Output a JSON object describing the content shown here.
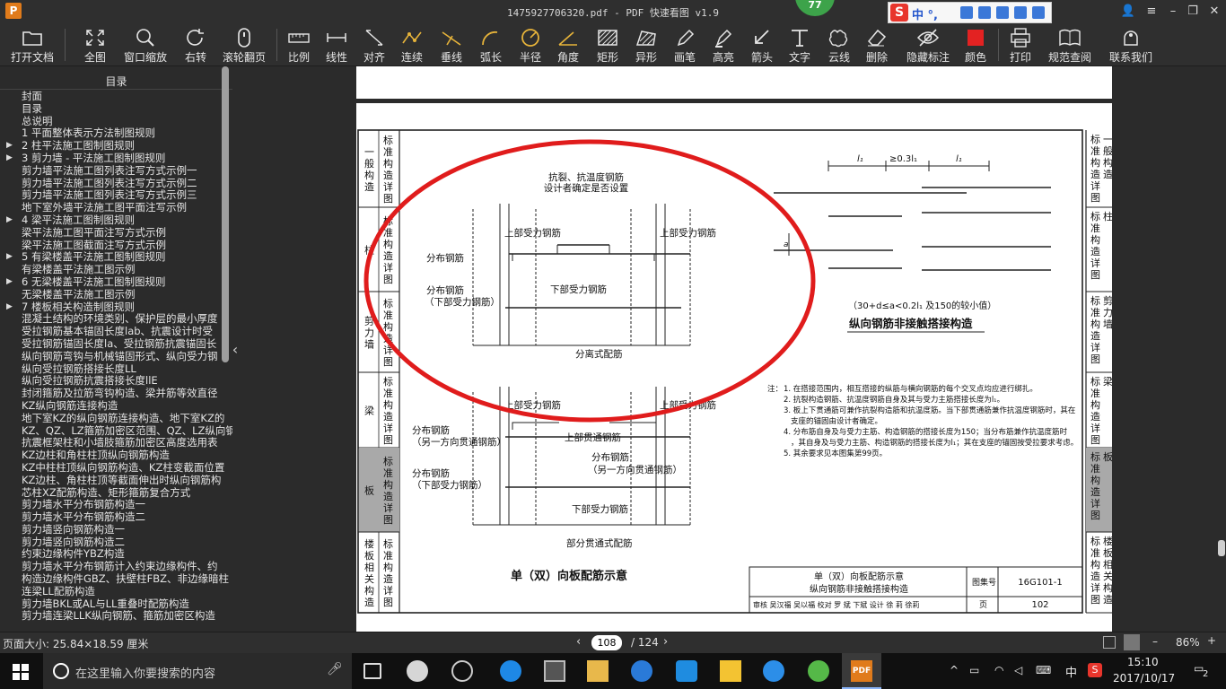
{
  "window": {
    "title": "1475927706320.pdf - PDF 快速看图 v1.9",
    "badge": "77",
    "app_logo": "P"
  },
  "ime": {
    "label": "中 °,",
    "logo": "S"
  },
  "toolbar": {
    "buttons": [
      "打开文档",
      "全图",
      "窗口缩放",
      "右转",
      "滚轮翻页",
      "比例",
      "线性",
      "对齐",
      "连续",
      "垂线",
      "弧长",
      "半径",
      "角度",
      "矩形",
      "异形",
      "画笔",
      "高亮",
      "箭头",
      "文字",
      "云线",
      "删除",
      "隐藏标注",
      "颜色",
      "打印",
      "规范查阅",
      "联系我们"
    ],
    "color_swatch": "#e32222"
  },
  "sidebar": {
    "header": "目录",
    "items": [
      {
        "label": "封面",
        "expandable": false
      },
      {
        "label": "目录",
        "expandable": false
      },
      {
        "label": "总说明",
        "expandable": false
      },
      {
        "label": "1 平面整体表示方法制图规则",
        "expandable": false
      },
      {
        "label": "2 柱平法施工图制图规则",
        "expandable": true
      },
      {
        "label": "3 剪力墙 - 平法施工图制图规则",
        "expandable": true
      },
      {
        "label": "剪力墙平法施工图列表注写方式示例一",
        "expandable": false
      },
      {
        "label": "剪力墙平法施工图列表注写方式示例二",
        "expandable": false
      },
      {
        "label": "剪力墙平法施工图列表注写方式示例三",
        "expandable": false
      },
      {
        "label": "地下室外墙平法施工图平面注写示例",
        "expandable": false
      },
      {
        "label": "4 梁平法施工图制图规则",
        "expandable": true
      },
      {
        "label": "梁平法施工图平面注写方式示例",
        "expandable": false
      },
      {
        "label": "梁平法施工图截面注写方式示例",
        "expandable": false
      },
      {
        "label": "5 有梁楼盖平法施工图制图规则",
        "expandable": true
      },
      {
        "label": "有梁楼盖平法施工图示例",
        "expandable": false
      },
      {
        "label": "6 无梁楼盖平法施工图制图规则",
        "expandable": true
      },
      {
        "label": "无梁楼盖平法施工图示例",
        "expandable": false
      },
      {
        "label": "7 楼板相关构造制图规则",
        "expandable": true
      },
      {
        "label": "混凝土结构的环境类别、保护层的最小厚度",
        "expandable": false
      },
      {
        "label": "受拉钢筋基本锚固长度lab、抗震设计时受",
        "expandable": false
      },
      {
        "label": "受拉钢筋锚固长度la、受拉钢筋抗震锚固长",
        "expandable": false
      },
      {
        "label": "纵向钢筋弯钩与机械锚固形式、纵向受力钢",
        "expandable": false
      },
      {
        "label": "纵向受拉钢筋搭接长度LL",
        "expandable": false
      },
      {
        "label": "纵向受拉钢筋抗震搭接长度llE",
        "expandable": false
      },
      {
        "label": "封闭箍筋及拉筋弯钩构造、梁并筋等效直径",
        "expandable": false
      },
      {
        "label": "KZ纵向钢筋连接构造",
        "expandable": false
      },
      {
        "label": "地下室KZ的纵向钢筋连接构造、地下室KZ的",
        "expandable": false
      },
      {
        "label": "KZ、QZ、LZ箍筋加密区范围、QZ、LZ纵向钢",
        "expandable": false
      },
      {
        "label": "抗震框架柱和小墙肢箍筋加密区高度选用表",
        "expandable": false
      },
      {
        "label": "KZ边柱和角柱柱顶纵向钢筋构造",
        "expandable": false
      },
      {
        "label": "KZ中柱柱顶纵向钢筋构造、KZ柱变截面位置",
        "expandable": false
      },
      {
        "label": "KZ边柱、角柱柱顶等截面伸出时纵向钢筋构",
        "expandable": false
      },
      {
        "label": "芯柱XZ配筋构造、矩形箍筋复合方式",
        "expandable": false
      },
      {
        "label": "剪力墙水平分布钢筋构造一",
        "expandable": false
      },
      {
        "label": "剪力墙水平分布钢筋构造二",
        "expandable": false
      },
      {
        "label": "剪力墙竖向钢筋构造一",
        "expandable": false
      },
      {
        "label": "剪力墙竖向钢筋构造二",
        "expandable": false
      },
      {
        "label": "约束边缘构件YBZ构造",
        "expandable": false
      },
      {
        "label": "剪力墙水平分布钢筋计入约束边缘构件、约",
        "expandable": false
      },
      {
        "label": "构造边缘构件GBZ、扶壁柱FBZ、非边缘暗柱",
        "expandable": false
      },
      {
        "label": "连梁LL配筋构造",
        "expandable": false
      },
      {
        "label": "剪力墙BKL或AL与LL重叠时配筋构造",
        "expandable": false
      },
      {
        "label": "剪力墙连梁LLK纵向钢筋、箍筋加密区构造",
        "expandable": false
      }
    ]
  },
  "drawing": {
    "left_tabs": [
      {
        "title": "一般构造",
        "sub": "标准构造详图"
      },
      {
        "title": "柱",
        "sub": "标准构造详图"
      },
      {
        "title": "剪力墙",
        "sub": "标准构造详图"
      },
      {
        "title": "梁",
        "sub": "标准构造详图"
      },
      {
        "title": "板",
        "sub": "标准构造详图"
      },
      {
        "title": "楼板相关构造",
        "sub": "标准构造详图"
      }
    ],
    "right_tabs": [
      "标准构造详图 一般构造",
      "标准构造详图 柱",
      "标准构造详图 剪力墙",
      "标准构造详图 梁",
      "标准构造详图 板",
      "标准构造详图 楼板相关构造"
    ],
    "top_labels": {
      "anti_crack": "抗裂、抗温度钢筋",
      "designer": "设计者确定是否设置",
      "upper_left": "上部受力钢筋",
      "upper_right": "上部受力钢筋",
      "dist1": "分布钢筋",
      "dist2": "分布钢筋",
      "dist2_sub": "（下部受力钢筋）",
      "lower": "下部受力钢筋",
      "caption1": "分离式配筋"
    },
    "bottom_labels": {
      "upper_left": "上部受力钢筋",
      "upper_right": "上部受力钢筋",
      "dist1": "分布钢筋",
      "dist1_sub": "（另一方向贯通钢筋）",
      "upper_through": "上部贯通钢筋",
      "dist_b": "分布钢筋",
      "dist_b_sub": "（另一方向贯通钢筋）",
      "dist2": "分布钢筋",
      "dist2_sub": "（下部受力钢筋）",
      "lower": "下部受力钢筋",
      "caption2": "部分贯通式配筋"
    },
    "main_title": "单（双）向板配筋示意",
    "lap": {
      "l1": "l₁",
      "gap": "≥0.3l₁",
      "l2": "l₁",
      "a": "a",
      "formula": "（30+d≤a<0.2l₁ 及150的较小值）",
      "title": "纵向钢筋非接触搭接构造"
    },
    "notes_label": "注：",
    "notes": [
      "1. 在搭接范围内，相互搭接的纵筋与横向钢筋的每个交叉点均应进行绑扎。",
      "2. 抗裂构造钢筋、抗温度钢筋自身及其与受力主筋搭接长度为l₁。",
      "3. 板上下贯通筋可兼作抗裂构造筋和抗温度筋。当下部贯通筋兼作抗温度钢筋时，其在支座的锚固由设计者确定。",
      "4. 分布筋自身及与受力主筋、构造钢筋的搭接长度为150；当分布筋兼作抗温度筋时，其自身及与受力主筋、构造钢筋的搭接长度为l₁；其在支座的锚固按受拉要求考虑。",
      "5. 其余要求见本图集第99页。"
    ],
    "title_block": {
      "line1": "单（双）向板配筋示意",
      "line2": "纵向钢筋非接触搭接构造",
      "atlas_label": "图集号",
      "atlas_no": "16G101-1",
      "row": "审核 吴汉福 吴以福 校对 罗 斌 下斌 设计 徐 莉 徐莉",
      "page_label": "页",
      "page_no": "102"
    }
  },
  "statusbar": {
    "page_size": "页面大小: 25.84×18.59 厘米",
    "current_page": "108",
    "total_pages": "/ 124",
    "zoom": "86%"
  },
  "taskbar": {
    "search_placeholder": "在这里输入你要搜索的内容",
    "ime": "中",
    "time": "15:10",
    "date": "2017/10/17",
    "notifications": "2"
  }
}
